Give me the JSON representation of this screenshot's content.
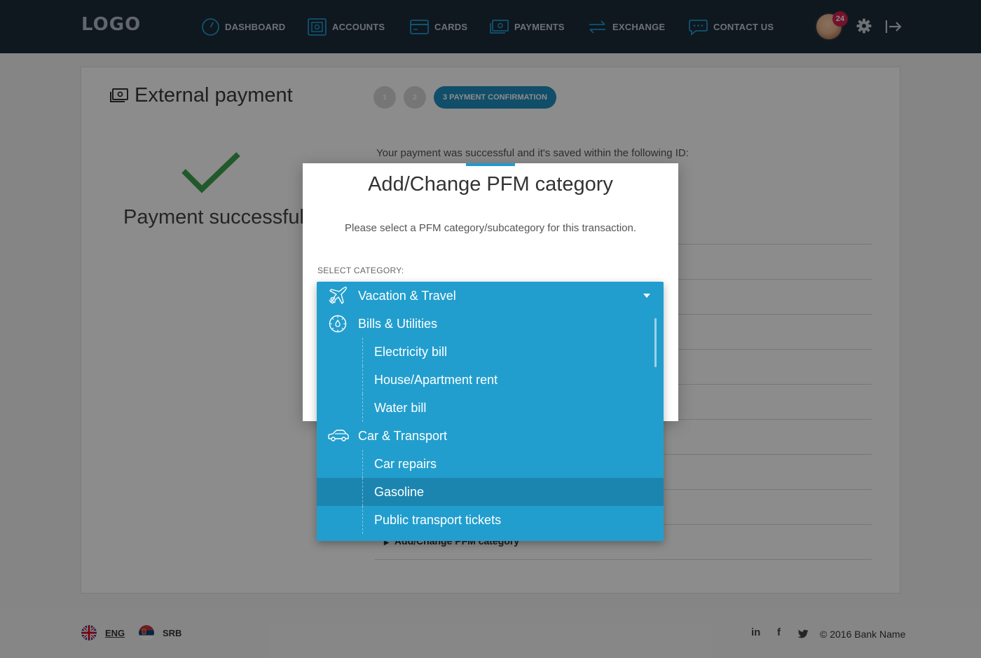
{
  "header": {
    "logo": "LOGO",
    "nav": [
      {
        "label": "DASHBOARD",
        "icon": "dashboard-icon"
      },
      {
        "label": "ACCOUNTS",
        "icon": "accounts-icon"
      },
      {
        "label": "CARDS",
        "icon": "card-icon"
      },
      {
        "label": "PAYMENTS",
        "icon": "payments-icon"
      },
      {
        "label": "EXCHANGE",
        "icon": "exchange-icon"
      },
      {
        "label": "CONTACT US",
        "icon": "chat-icon"
      }
    ],
    "notification_count": "24"
  },
  "page": {
    "title": "External payment",
    "steps": [
      "1",
      "2"
    ],
    "active_step": "3 PAYMENT CONFIRMATION",
    "success_text": "Payment successful",
    "saved_text": "Your payment was successful and it's saved within the following ID:",
    "pfm_link": "Add/Change PFM category"
  },
  "modal": {
    "title": "Add/Change PFM category",
    "description": "Please select a PFM category/subcategory for this transaction.",
    "select_label": "SELECT CATEGORY:"
  },
  "dropdown": {
    "selected": "Vacation & Travel",
    "items": [
      {
        "label": "Bills & Utilities",
        "type": "category",
        "icon": "utilities-icon"
      },
      {
        "label": "Electricity bill",
        "type": "subcategory"
      },
      {
        "label": "House/Apartment rent",
        "type": "subcategory"
      },
      {
        "label": "Water bill",
        "type": "subcategory"
      },
      {
        "label": "Car & Transport",
        "type": "category",
        "icon": "car-icon"
      },
      {
        "label": "Car repairs",
        "type": "subcategory"
      },
      {
        "label": "Gasoline",
        "type": "subcategory",
        "highlighted": true
      },
      {
        "label": "Public transport tickets",
        "type": "subcategory"
      }
    ]
  },
  "footer": {
    "languages": [
      {
        "code": "ENG",
        "active": true
      },
      {
        "code": "SRB",
        "active": false
      }
    ],
    "social": [
      "in",
      "f"
    ],
    "copyright": "© 2016 Bank Name"
  },
  "colors": {
    "header_bg": "#1c2a3a",
    "accent": "#1f8fbf",
    "dropdown_bg": "#229ece",
    "dropdown_highlight": "#1b85b0",
    "success_green": "#3fa34d"
  }
}
